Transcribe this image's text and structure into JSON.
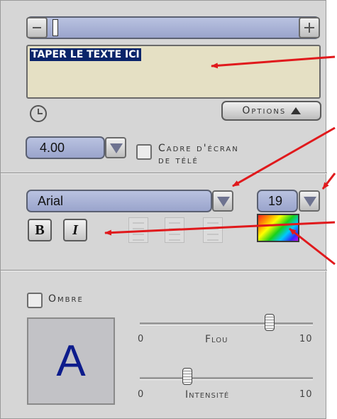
{
  "text_area": {
    "value": "TAPER LE TEXTE ICI"
  },
  "toolbar": {
    "minus_icon": "minus-icon",
    "plus_icon": "plus-icon"
  },
  "options_button": {
    "label": "Options"
  },
  "duration": {
    "value": "4.00",
    "icon": "clock-icon"
  },
  "tv_frame": {
    "line1": "Cadre d'écran",
    "line2": "de télé",
    "checked": false
  },
  "font": {
    "family": "Arial",
    "size": "19",
    "bold_label": "B",
    "italic_label": "I"
  },
  "shadow": {
    "label": "Ombre",
    "checked": false,
    "preview_letter": "A",
    "blur": {
      "label": "Flou",
      "min": "0",
      "max": "10",
      "value_fraction": 0.76
    },
    "intensity": {
      "label": "Intensité",
      "min": "0",
      "max": "10",
      "value_fraction": 0.29
    }
  },
  "colors": {
    "arrow": "#e0191c",
    "text_highlight": "#0a246a",
    "preview_letter": "#0d1c8c"
  }
}
